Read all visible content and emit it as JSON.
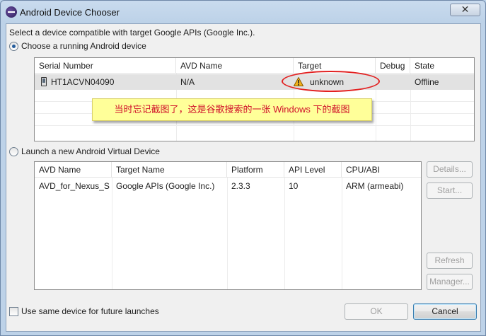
{
  "window": {
    "title": "Android Device Chooser",
    "close_glyph": "✕",
    "icon": "eclipse-icon"
  },
  "prompt": "Select a device compatible with target Google APIs (Google Inc.).",
  "running": {
    "radio_label": "Choose a running Android device",
    "checked": true,
    "columns": [
      "Serial Number",
      "AVD Name",
      "Target",
      "Debug",
      "State"
    ],
    "rows": [
      {
        "serial": "HT1ACVN04090",
        "avd_name": "N/A",
        "target": "unknown",
        "debug": "",
        "state": "Offline",
        "device_icon": "phone-icon",
        "target_icon": "warning-icon"
      }
    ]
  },
  "launch": {
    "radio_label": "Launch a new Android Virtual Device",
    "checked": false,
    "columns": [
      "AVD Name",
      "Target Name",
      "Platform",
      "API Level",
      "CPU/ABI"
    ],
    "rows": [
      {
        "avd_name": "AVD_for_Nexus_S",
        "target_name": "Google APIs (Google Inc.)",
        "platform": "2.3.3",
        "api_level": "10",
        "cpu_abi": "ARM (armeabi)"
      }
    ],
    "buttons": {
      "details": "Details...",
      "start": "Start...",
      "refresh": "Refresh",
      "manager": "Manager..."
    }
  },
  "checkbox": {
    "label": "Use same device for future launches",
    "checked": false
  },
  "footer": {
    "ok": "OK",
    "cancel": "Cancel"
  },
  "annotation": {
    "note": "当时忘记截图了，这是谷歌搜索的一张 Windows 下的截图",
    "oval_color": "#e22020",
    "note_bg": "#ffff99",
    "note_text_color": "#d0102a"
  }
}
